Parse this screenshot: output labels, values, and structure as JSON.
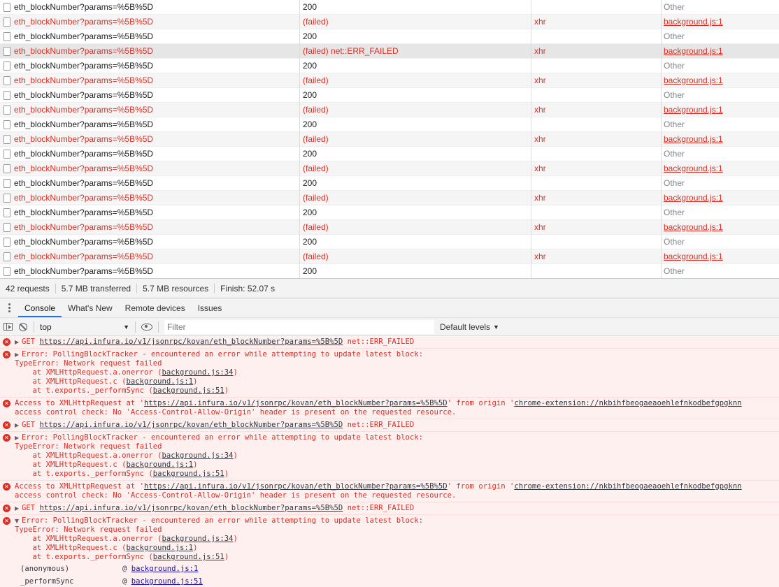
{
  "network": {
    "rows": [
      {
        "name": "eth_blockNumber?params=%5B%5D",
        "status": "200",
        "type": "",
        "initiator": "Other",
        "failed": false
      },
      {
        "name": "eth_blockNumber?params=%5B%5D",
        "status": "(failed)",
        "type": "xhr",
        "initiator": "background.js:1",
        "failed": true
      },
      {
        "name": "eth_blockNumber?params=%5B%5D",
        "status": "200",
        "type": "",
        "initiator": "Other",
        "failed": false
      },
      {
        "name": "eth_blockNumber?params=%5B%5D",
        "status": "(failed) net::ERR_FAILED",
        "type": "xhr",
        "initiator": "background.js:1",
        "failed": true,
        "selected": true
      },
      {
        "name": "eth_blockNumber?params=%5B%5D",
        "status": "200",
        "type": "",
        "initiator": "Other",
        "failed": false
      },
      {
        "name": "eth_blockNumber?params=%5B%5D",
        "status": "(failed)",
        "type": "xhr",
        "initiator": "background.js:1",
        "failed": true
      },
      {
        "name": "eth_blockNumber?params=%5B%5D",
        "status": "200",
        "type": "",
        "initiator": "Other",
        "failed": false
      },
      {
        "name": "eth_blockNumber?params=%5B%5D",
        "status": "(failed)",
        "type": "xhr",
        "initiator": "background.js:1",
        "failed": true
      },
      {
        "name": "eth_blockNumber?params=%5B%5D",
        "status": "200",
        "type": "",
        "initiator": "Other",
        "failed": false
      },
      {
        "name": "eth_blockNumber?params=%5B%5D",
        "status": "(failed)",
        "type": "xhr",
        "initiator": "background.js:1",
        "failed": true
      },
      {
        "name": "eth_blockNumber?params=%5B%5D",
        "status": "200",
        "type": "",
        "initiator": "Other",
        "failed": false
      },
      {
        "name": "eth_blockNumber?params=%5B%5D",
        "status": "(failed)",
        "type": "xhr",
        "initiator": "background.js:1",
        "failed": true
      },
      {
        "name": "eth_blockNumber?params=%5B%5D",
        "status": "200",
        "type": "",
        "initiator": "Other",
        "failed": false
      },
      {
        "name": "eth_blockNumber?params=%5B%5D",
        "status": "(failed)",
        "type": "xhr",
        "initiator": "background.js:1",
        "failed": true
      },
      {
        "name": "eth_blockNumber?params=%5B%5D",
        "status": "200",
        "type": "",
        "initiator": "Other",
        "failed": false
      },
      {
        "name": "eth_blockNumber?params=%5B%5D",
        "status": "(failed)",
        "type": "xhr",
        "initiator": "background.js:1",
        "failed": true
      },
      {
        "name": "eth_blockNumber?params=%5B%5D",
        "status": "200",
        "type": "",
        "initiator": "Other",
        "failed": false
      },
      {
        "name": "eth_blockNumber?params=%5B%5D",
        "status": "(failed)",
        "type": "xhr",
        "initiator": "background.js:1",
        "failed": true
      },
      {
        "name": "eth_blockNumber?params=%5B%5D",
        "status": "200",
        "type": "",
        "initiator": "Other",
        "failed": false
      }
    ]
  },
  "summary": {
    "requests": "42 requests",
    "transferred": "5.7 MB transferred",
    "resources": "5.7 MB resources",
    "finish": "Finish: 52.07 s"
  },
  "drawer": {
    "tabs": [
      "Console",
      "What's New",
      "Remote devices",
      "Issues"
    ],
    "active": "Console"
  },
  "toolbar": {
    "context": "top",
    "filter_placeholder": "Filter",
    "levels": "Default levels"
  },
  "console": {
    "messages": [
      {
        "kind": "get",
        "text": "GET ",
        "url": "https://api.infura.io/v1/jsonrpc/kovan/eth_blockNumber?params=%5B%5D",
        "suffix": " net::ERR_FAILED"
      },
      {
        "kind": "polling",
        "expanded": false,
        "lines": [
          "Error: PollingBlockTracker - encountered an error while attempting to update latest block:",
          "TypeError: Network request failed"
        ],
        "stack": [
          {
            "pre": "    at XMLHttpRequest.a.onerror (",
            "link": "background.js:34",
            "post": ")"
          },
          {
            "pre": "    at XMLHttpRequest.c (",
            "link": "background.js:1",
            "post": ")"
          },
          {
            "pre": "    at t.exports._performSync (",
            "link": "background.js:51",
            "post": ")"
          }
        ]
      },
      {
        "kind": "cors",
        "pre": "Access to XMLHttpRequest at '",
        "url": "https://api.infura.io/v1/jsonrpc/kovan/eth_blockNumber?params=%5B%5D",
        "mid": "' from origin '",
        "origin": "chrome-extension://nkbihfbeogaeaoehlefnkodbefgpgknn",
        "line2": "access control check: No 'Access-Control-Allow-Origin' header is present on the requested resource."
      },
      {
        "kind": "get",
        "text": "GET ",
        "url": "https://api.infura.io/v1/jsonrpc/kovan/eth_blockNumber?params=%5B%5D",
        "suffix": " net::ERR_FAILED"
      },
      {
        "kind": "polling",
        "expanded": false,
        "lines": [
          "Error: PollingBlockTracker - encountered an error while attempting to update latest block:",
          "TypeError: Network request failed"
        ],
        "stack": [
          {
            "pre": "    at XMLHttpRequest.a.onerror (",
            "link": "background.js:34",
            "post": ")"
          },
          {
            "pre": "    at XMLHttpRequest.c (",
            "link": "background.js:1",
            "post": ")"
          },
          {
            "pre": "    at t.exports._performSync (",
            "link": "background.js:51",
            "post": ")"
          }
        ]
      },
      {
        "kind": "cors",
        "pre": "Access to XMLHttpRequest at '",
        "url": "https://api.infura.io/v1/jsonrpc/kovan/eth_blockNumber?params=%5B%5D",
        "mid": "' from origin '",
        "origin": "chrome-extension://nkbihfbeogaeaoehlefnkodbefgpgknn",
        "line2": "access control check: No 'Access-Control-Allow-Origin' header is present on the requested resource."
      },
      {
        "kind": "get",
        "text": "GET ",
        "url": "https://api.infura.io/v1/jsonrpc/kovan/eth_blockNumber?params=%5B%5D",
        "suffix": " net::ERR_FAILED"
      },
      {
        "kind": "polling",
        "expanded": true,
        "lines": [
          "Error: PollingBlockTracker - encountered an error while attempting to update latest block:",
          "TypeError: Network request failed"
        ],
        "stack": [
          {
            "pre": "    at XMLHttpRequest.a.onerror (",
            "link": "background.js:34",
            "post": ")"
          },
          {
            "pre": "    at XMLHttpRequest.c (",
            "link": "background.js:1",
            "post": ")"
          },
          {
            "pre": "    at t.exports._performSync (",
            "link": "background.js:51",
            "post": ")"
          }
        ],
        "callstack": [
          {
            "fn": "(anonymous)",
            "link": "background.js:1"
          },
          {
            "fn": "_performSync",
            "link": "background.js:51"
          }
        ]
      }
    ]
  }
}
